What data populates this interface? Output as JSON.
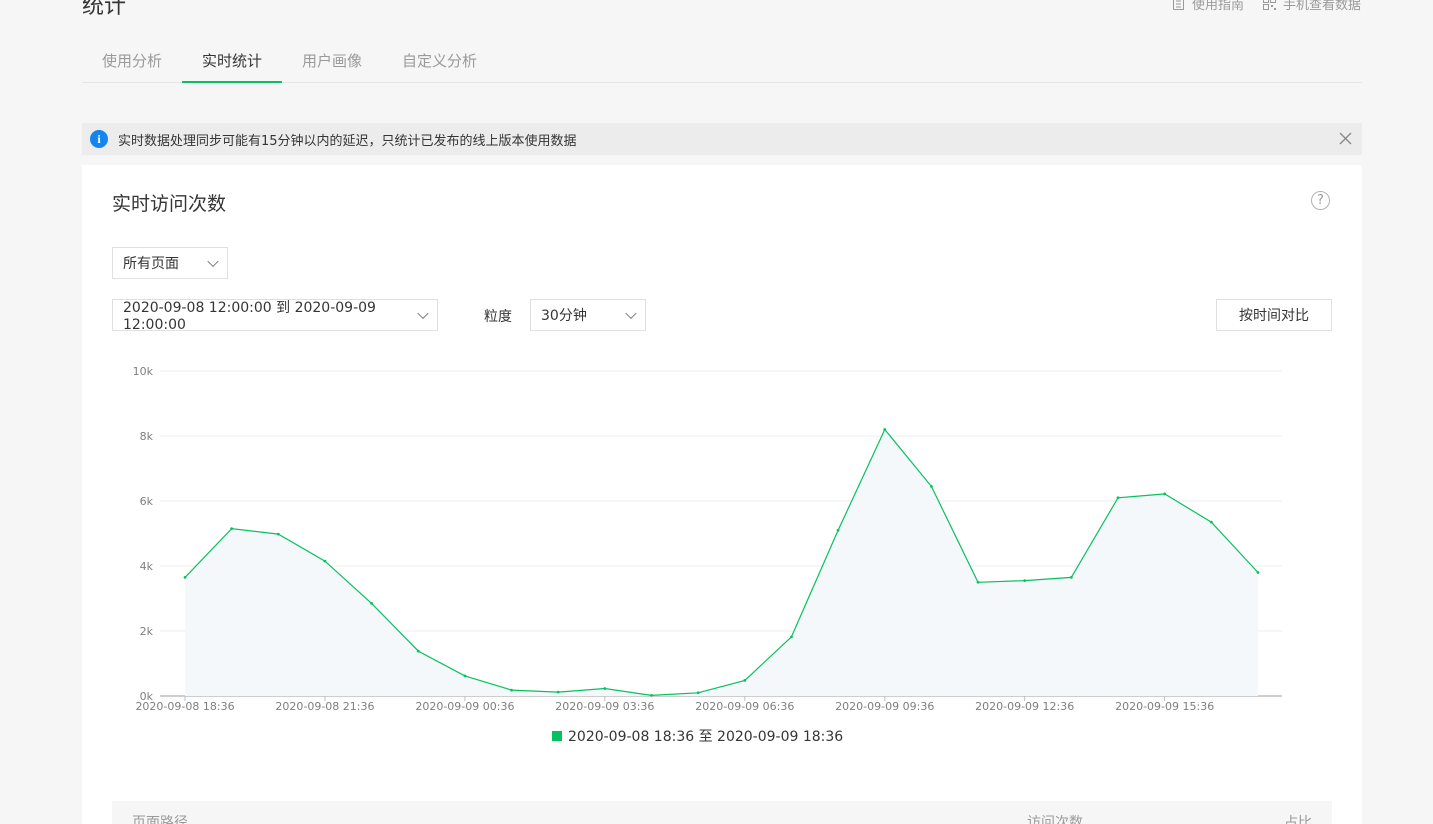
{
  "page_title": "统计",
  "top_links": {
    "guide": "使用指南",
    "mobile": "手机查看数据"
  },
  "tabs": [
    "使用分析",
    "实时统计",
    "用户画像",
    "自定义分析"
  ],
  "active_tab": 1,
  "notice": "实时数据处理同步可能有15分钟以内的延迟，只统计已发布的线上版本使用数据",
  "card": {
    "title": "实时访问次数",
    "page_select": "所有页面",
    "date_range": "2020-09-08 12:00:00 到 2020-09-09 12:00:00",
    "granularity_label": "粒度",
    "granularity": "30分钟",
    "compare_button": "按时间对比"
  },
  "table": {
    "col_path": "页面路径",
    "col_visits": "访问次数",
    "col_ratio": "占比"
  },
  "chart_data": {
    "type": "area",
    "x": [
      "2020-09-08 18:36",
      "2020-09-08 19:36",
      "2020-09-08 20:36",
      "2020-09-08 21:36",
      "2020-09-08 22:36",
      "2020-09-08 23:36",
      "2020-09-09 00:36",
      "2020-09-09 01:36",
      "2020-09-09 02:36",
      "2020-09-09 03:36",
      "2020-09-09 04:36",
      "2020-09-09 05:36",
      "2020-09-09 06:36",
      "2020-09-09 07:36",
      "2020-09-09 08:36",
      "2020-09-09 09:36",
      "2020-09-09 10:36",
      "2020-09-09 11:36",
      "2020-09-09 12:36",
      "2020-09-09 13:36",
      "2020-09-09 14:36",
      "2020-09-09 15:36",
      "2020-09-09 16:36",
      "2020-09-09 17:36"
    ],
    "series": [
      {
        "name": "2020-09-08 18:36 至 2020-09-09 18:36",
        "values": [
          3650,
          5150,
          4980,
          4150,
          2850,
          1380,
          620,
          180,
          120,
          230,
          20,
          100,
          480,
          1820,
          5100,
          8200,
          6450,
          3500,
          3550,
          3650,
          6100,
          6220,
          5350,
          3800
        ]
      }
    ],
    "x_tick_labels": [
      "2020-09-08 18:36",
      "2020-09-08 21:36",
      "2020-09-09 00:36",
      "2020-09-09 03:36",
      "2020-09-09 06:36",
      "2020-09-09 09:36",
      "2020-09-09 12:36",
      "2020-09-09 15:36"
    ],
    "y_tick_labels": [
      "0k",
      "2k",
      "4k",
      "6k",
      "8k",
      "10k"
    ],
    "ylim": [
      0,
      10000
    ],
    "color": "#07c160",
    "grid": true,
    "legend_position": "bottom-center"
  }
}
